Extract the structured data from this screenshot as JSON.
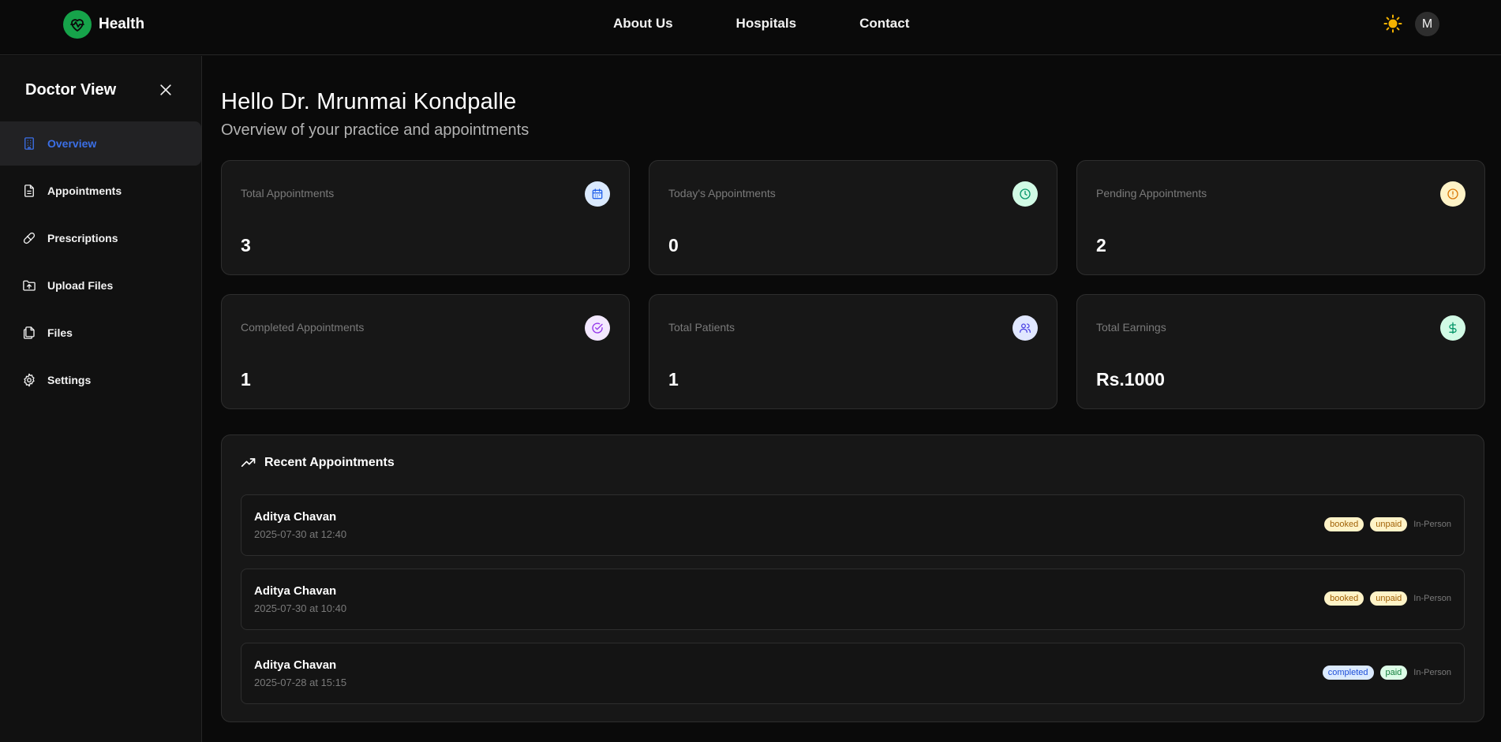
{
  "header": {
    "brand": "Health",
    "nav": [
      "About Us",
      "Hospitals",
      "Contact"
    ],
    "avatar_initial": "M"
  },
  "sidebar": {
    "title": "Doctor View",
    "items": [
      {
        "label": "Overview",
        "icon": "building-icon",
        "active": true
      },
      {
        "label": "Appointments",
        "icon": "document-icon"
      },
      {
        "label": "Prescriptions",
        "icon": "pill-icon"
      },
      {
        "label": "Upload Files",
        "icon": "folder-upload-icon"
      },
      {
        "label": "Files",
        "icon": "files-icon"
      },
      {
        "label": "Settings",
        "icon": "gear-icon"
      }
    ]
  },
  "main": {
    "greeting": "Hello Dr. Mrunmai Kondpalle",
    "subtitle": "Overview of your practice and appointments",
    "stats": [
      {
        "label": "Total Appointments",
        "value": "3",
        "icon": "calendar-icon",
        "bg": "#dbeafe",
        "fg": "#2563eb"
      },
      {
        "label": "Today's Appointments",
        "value": "0",
        "icon": "clock-icon",
        "bg": "#d1fae5",
        "fg": "#059669"
      },
      {
        "label": "Pending Appointments",
        "value": "2",
        "icon": "alert-circle-icon",
        "bg": "#fef3c7",
        "fg": "#d97706"
      },
      {
        "label": "Completed Appointments",
        "value": "1",
        "icon": "check-circle-icon",
        "bg": "#f3e8ff",
        "fg": "#9333ea"
      },
      {
        "label": "Total Patients",
        "value": "1",
        "icon": "users-icon",
        "bg": "#e0e7ff",
        "fg": "#4f46e5"
      },
      {
        "label": "Total Earnings",
        "value": "Rs.1000",
        "icon": "dollar-icon",
        "bg": "#d1fae5",
        "fg": "#059669"
      }
    ],
    "recent": {
      "title": "Recent Appointments",
      "items": [
        {
          "name": "Aditya Chavan",
          "when": "2025-07-30 at 12:40",
          "status": "booked",
          "payment": "unpaid",
          "mode": "In-Person"
        },
        {
          "name": "Aditya Chavan",
          "when": "2025-07-30 at 10:40",
          "status": "booked",
          "payment": "unpaid",
          "mode": "In-Person"
        },
        {
          "name": "Aditya Chavan",
          "when": "2025-07-28 at 15:15",
          "status": "completed",
          "payment": "paid",
          "mode": "In-Person"
        }
      ]
    }
  },
  "colors": {
    "accent": "#3b6fe6",
    "brand": "#16a34a",
    "sun": "#f5b301"
  }
}
